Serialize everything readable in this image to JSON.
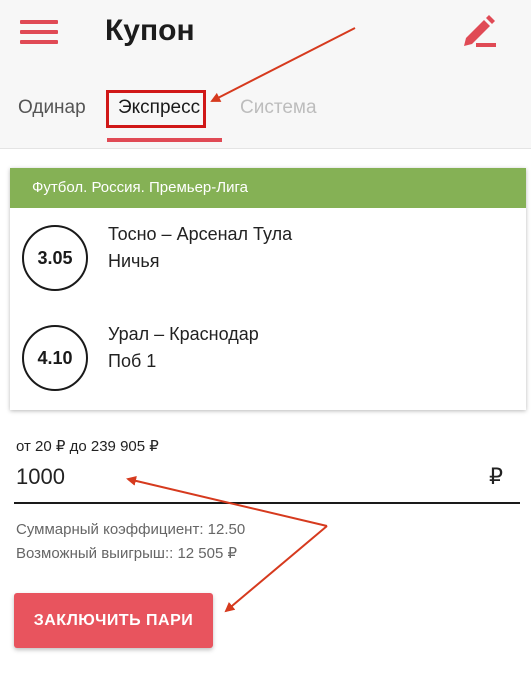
{
  "header": {
    "title": "Купон",
    "menu_icon": "menu-icon",
    "edit_icon": "pencil-icon"
  },
  "tabs": [
    {
      "label": "Одинар",
      "active": false
    },
    {
      "label": "Экспресс",
      "active": true
    },
    {
      "label": "Система",
      "active": false
    }
  ],
  "coupon": {
    "league": "Футбол. Россия. Премьер-Лига",
    "bets": [
      {
        "odds": "3.05",
        "match": "Тосно – Арсенал Тула",
        "outcome": "Ничья"
      },
      {
        "odds": "4.10",
        "match": "Урал – Краснодар",
        "outcome": "Поб 1"
      }
    ]
  },
  "stake": {
    "range": "от 20 ₽ до 239 905 ₽",
    "value": "1000",
    "currency": "₽"
  },
  "summary": {
    "total_coefficient": "Суммарный коэффициент: 12.50",
    "possible_win": "Возможный выигрыш:: 12 505 ₽"
  },
  "actions": {
    "place_bet_label": "ЗАКЛЮЧИТЬ ПАРИ"
  },
  "colors": {
    "accent": "#e04a55",
    "league_bar": "#85b155",
    "annotation": "#d01818"
  }
}
